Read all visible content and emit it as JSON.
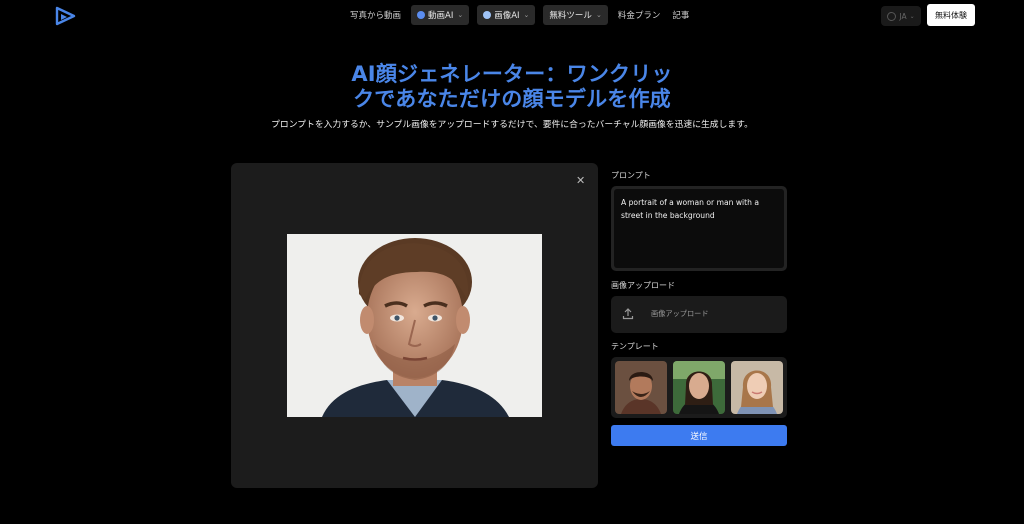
{
  "nav": {
    "logo": "play-logo-icon",
    "items": [
      {
        "type": "link",
        "label": "写真から動画"
      },
      {
        "type": "dropdown",
        "label": "動画AI",
        "icon": "video-icon"
      },
      {
        "type": "dropdown",
        "label": "画像AI",
        "icon": "image-icon"
      },
      {
        "type": "dropdown",
        "label": "無料ツール"
      },
      {
        "type": "link",
        "label": "料金プラン"
      },
      {
        "type": "link",
        "label": "記事"
      }
    ],
    "language": "JA",
    "cta": "無料体験"
  },
  "hero": {
    "title_line1": "AI顔ジェネレーター：ワンクリッ",
    "title_line2": "クであなただけの顔モデルを作成",
    "subtitle": "プロンプトを入力するか、サンプル画像をアップロードするだけで、要件に合ったバーチャル顔画像を迅速に生成します。"
  },
  "form": {
    "prompt_label": "プロンプト",
    "prompt_value": "A portrait of a woman or man with a street in the background",
    "upload_label": "画像アップロード",
    "upload_button": "画像アップロード",
    "template_label": "テンプレート",
    "submit": "送信"
  },
  "colors": {
    "accent": "#4a86e8",
    "submit": "#3d7bf0",
    "background": "#000000",
    "panel": "#1c1c1c"
  }
}
